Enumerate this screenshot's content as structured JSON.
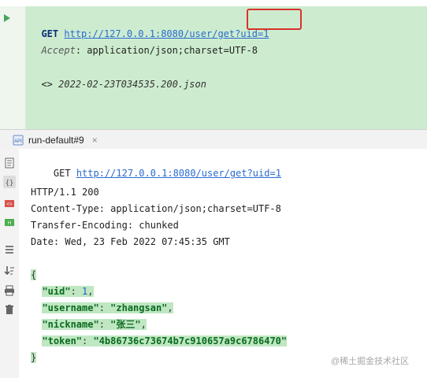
{
  "request": {
    "method": "GET",
    "url_base": "http://127.0.0.1:8080/user/get?",
    "url_query": "uid=1",
    "header_name": "Accept",
    "header_value": ": application/json;charset=UTF-8",
    "response_ref_prefix": "<>",
    "response_ref_file": "2022-02-23T034535.200.json"
  },
  "tab": {
    "icon": "api-run-icon",
    "icon_text": "API",
    "label": "run-default#9",
    "close": "×"
  },
  "sidebar": {
    "icons": [
      "document-icon",
      "json-view-icon",
      "html-view-icon",
      "html-view-icon-2",
      "soft-wrap-icon",
      "sort-icon",
      "print-icon",
      "delete-icon"
    ]
  },
  "response": {
    "request_line_method": "GET",
    "request_line_url": "http://127.0.0.1:8080/user/get?uid=1",
    "status_line": "HTTP/1.1 200",
    "headers": [
      "Content-Type: application/json;charset=UTF-8",
      "Transfer-Encoding: chunked",
      "Date: Wed, 23 Feb 2022 07:45:35 GMT"
    ],
    "json_open": "{",
    "json_close": "}",
    "json_fields": [
      {
        "key": "\"uid\"",
        "sep": ": ",
        "value": "1",
        "type": "number",
        "comma": ","
      },
      {
        "key": "\"username\"",
        "sep": ": ",
        "value": "\"zhangsan\"",
        "type": "string",
        "comma": ","
      },
      {
        "key": "\"nickname\"",
        "sep": ": ",
        "value": "\"张三\"",
        "type": "string",
        "comma": ","
      },
      {
        "key": "\"token\"",
        "sep": ": ",
        "value": "\"4b86736c73674b7c910657a9c6786470\"",
        "type": "string",
        "comma": ""
      }
    ]
  },
  "watermark": "@稀土掘金技术社区",
  "colors": {
    "editor_bg": "#cdeccf",
    "highlight_border": "#d8332b",
    "url": "#2a6bd1",
    "json_green": "#0a6a1f",
    "json_bg": "#bfe7c2"
  }
}
